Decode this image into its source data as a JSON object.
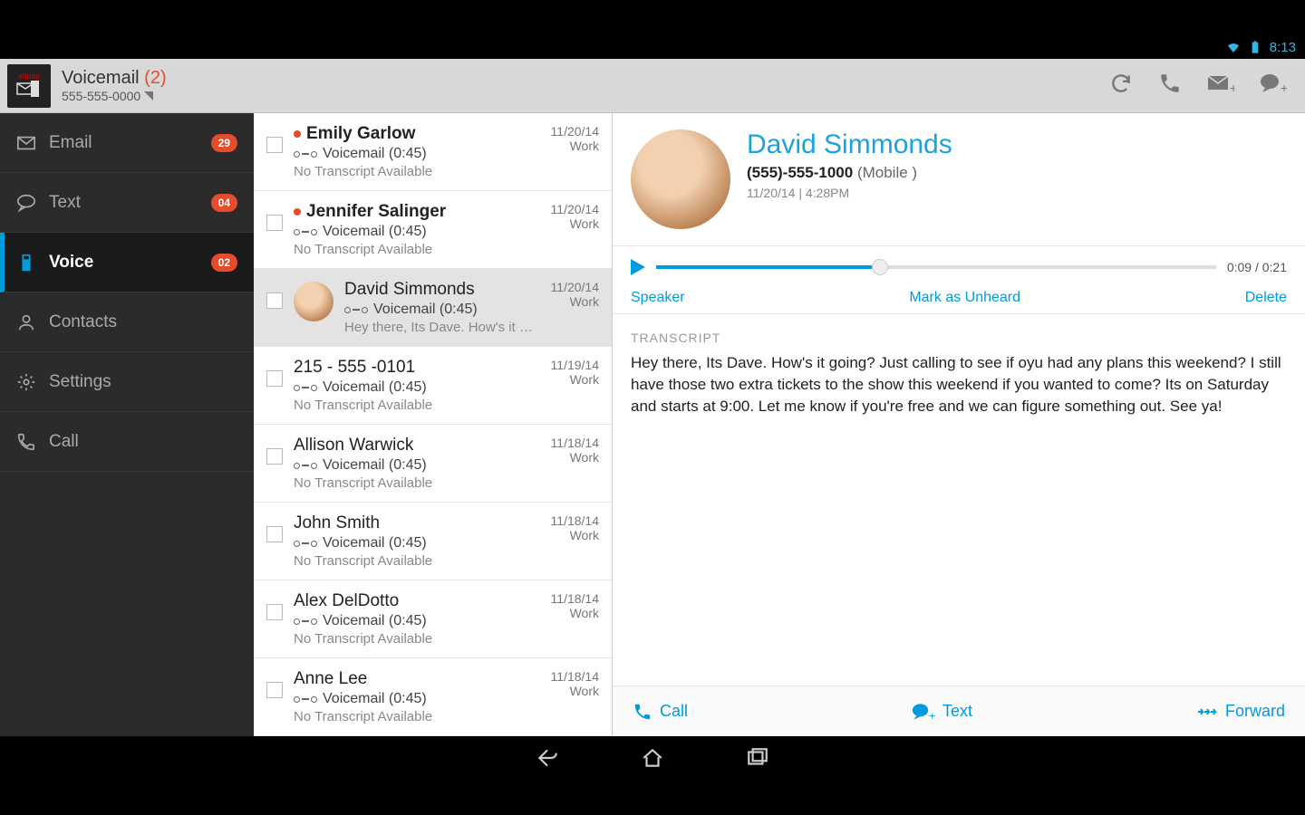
{
  "status": {
    "time": "8:13"
  },
  "appbar": {
    "title": "Voicemail",
    "count": "(2)",
    "phone": "555-555-0000"
  },
  "sidebar": [
    {
      "label": "Email",
      "badge": "29"
    },
    {
      "label": "Text",
      "badge": "04"
    },
    {
      "label": "Voice",
      "badge": "02"
    },
    {
      "label": "Contacts",
      "badge": ""
    },
    {
      "label": "Settings",
      "badge": ""
    },
    {
      "label": "Call",
      "badge": ""
    }
  ],
  "list": [
    {
      "name": "Emily Garlow",
      "unread": true,
      "vm": "Voicemail (0:45)",
      "preview": "No Transcript Available",
      "date": "11/20/14",
      "tag": "Work"
    },
    {
      "name": "Jennifer Salinger",
      "unread": true,
      "vm": "Voicemail (0:45)",
      "preview": "No Transcript Available",
      "date": "11/20/14",
      "tag": "Work"
    },
    {
      "name": "David Simmonds",
      "unread": false,
      "vm": "Voicemail (0:45)",
      "preview": "Hey there, Its Dave. How's it going...",
      "date": "11/20/14",
      "tag": "Work"
    },
    {
      "name": "215 - 555 -0101",
      "unread": false,
      "vm": "Voicemail (0:45)",
      "preview": "No Transcript Available",
      "date": "11/19/14",
      "tag": "Work"
    },
    {
      "name": "Allison Warwick",
      "unread": false,
      "vm": "Voicemail (0:45)",
      "preview": "No Transcript Available",
      "date": "11/18/14",
      "tag": "Work"
    },
    {
      "name": "John Smith",
      "unread": false,
      "vm": "Voicemail (0:45)",
      "preview": "No Transcript Available",
      "date": "11/18/14",
      "tag": "Work"
    },
    {
      "name": "Alex DelDotto",
      "unread": false,
      "vm": "Voicemail (0:45)",
      "preview": "No Transcript Available",
      "date": "11/18/14",
      "tag": "Work"
    },
    {
      "name": "Anne Lee",
      "unread": false,
      "vm": "Voicemail (0:45)",
      "preview": "No Transcript Available",
      "date": "11/18/14",
      "tag": "Work"
    }
  ],
  "detail": {
    "name": "David Simmonds",
    "phone": "(555)-555-1000",
    "type": "(Mobile )",
    "when": "11/20/14 | 4:28PM",
    "elapsed": "0:09",
    "total": "0:21",
    "speaker": "Speaker",
    "mark": "Mark as Unheard",
    "delete": "Delete",
    "transcript_label": "TRANSCRIPT",
    "transcript": "Hey there, Its Dave. How's it going? Just calling to see if oyu had any plans this weekend? I still have those two extra tickets to the show this weekend if you wanted to come? Its on Saturday and starts at 9:00. Let me know if you're free and we can figure something out. See ya!",
    "call": "Call",
    "text": "Text",
    "forward": "Forward"
  }
}
